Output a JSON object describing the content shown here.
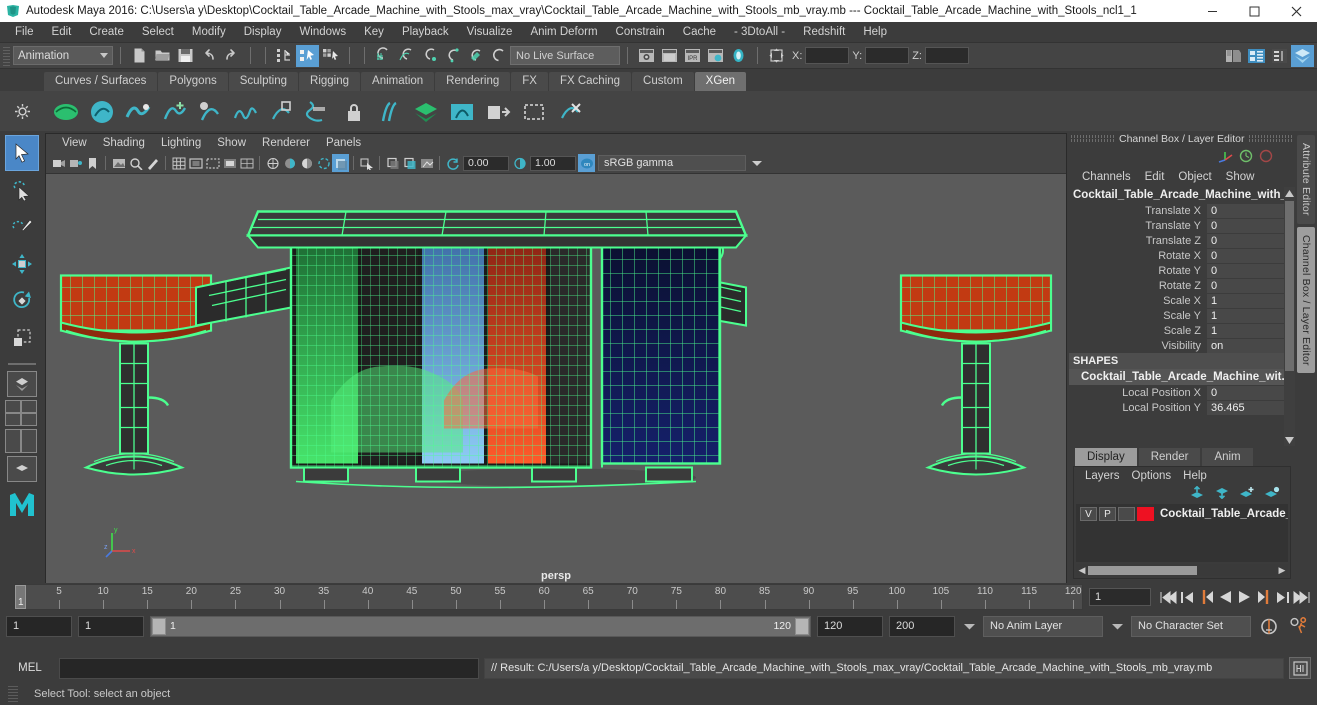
{
  "titlebar": {
    "app_title": "Autodesk Maya 2016: C:\\Users\\a y\\Desktop\\Cocktail_Table_Arcade_Machine_with_Stools_max_vray\\Cocktail_Table_Arcade_Machine_with_Stools_mb_vray.mb  ---  Cocktail_Table_Arcade_Machine_with_Stools_ncl1_1",
    "minimize": "–",
    "maximize": "❐",
    "close": "✕"
  },
  "menubar": {
    "items": [
      {
        "label": "File"
      },
      {
        "label": "Edit"
      },
      {
        "label": "Create"
      },
      {
        "label": "Select"
      },
      {
        "label": "Modify"
      },
      {
        "label": "Display"
      },
      {
        "label": "Windows"
      },
      {
        "label": "Key"
      },
      {
        "label": "Playback"
      },
      {
        "label": "Visualize"
      },
      {
        "label": "Anim Deform"
      },
      {
        "label": "Constrain"
      },
      {
        "label": "Cache"
      },
      {
        "label": "- 3DtoAll -"
      },
      {
        "label": "Redshift"
      },
      {
        "label": "Help"
      }
    ]
  },
  "statusline": {
    "menuset": "Animation",
    "live_surface": "No Live Surface",
    "coord_x_label": "X:",
    "coord_y_label": "Y:",
    "coord_z_label": "Z:",
    "coord_x_value": "",
    "coord_y_value": "",
    "coord_z_value": ""
  },
  "shelf": {
    "tabs": [
      {
        "label": "Curves / Surfaces",
        "active": false
      },
      {
        "label": "Polygons",
        "active": false
      },
      {
        "label": "Sculpting",
        "active": false
      },
      {
        "label": "Rigging",
        "active": false
      },
      {
        "label": "Animation",
        "active": false
      },
      {
        "label": "Rendering",
        "active": false
      },
      {
        "label": "FX",
        "active": false
      },
      {
        "label": "FX Caching",
        "active": false
      },
      {
        "label": "Custom",
        "active": false
      },
      {
        "label": "XGen",
        "active": true
      }
    ]
  },
  "viewport": {
    "menus": [
      {
        "label": "View"
      },
      {
        "label": "Shading"
      },
      {
        "label": "Lighting"
      },
      {
        "label": "Show"
      },
      {
        "label": "Renderer"
      },
      {
        "label": "Panels"
      }
    ],
    "exposure_value": "0.00",
    "gamma_value": "1.00",
    "color_space": "sRGB gamma",
    "camera_label": "persp",
    "axis_x": "x",
    "axis_y": "y",
    "axis_z": "z"
  },
  "channelbox": {
    "panel_title": "Channel Box / Layer Editor",
    "menus": [
      {
        "label": "Channels"
      },
      {
        "label": "Edit"
      },
      {
        "label": "Object"
      },
      {
        "label": "Show"
      }
    ],
    "object_name": "Cocktail_Table_Arcade_Machine_with_...",
    "attributes": [
      {
        "label": "Translate X",
        "value": "0"
      },
      {
        "label": "Translate Y",
        "value": "0"
      },
      {
        "label": "Translate Z",
        "value": "0"
      },
      {
        "label": "Rotate X",
        "value": "0"
      },
      {
        "label": "Rotate Y",
        "value": "0"
      },
      {
        "label": "Rotate Z",
        "value": "0"
      },
      {
        "label": "Scale X",
        "value": "1"
      },
      {
        "label": "Scale Y",
        "value": "1"
      },
      {
        "label": "Scale Z",
        "value": "1"
      },
      {
        "label": "Visibility",
        "value": "on"
      }
    ],
    "shapes_header": "SHAPES",
    "shape_name": "Cocktail_Table_Arcade_Machine_wit...",
    "shape_attributes": [
      {
        "label": "Local Position X",
        "value": "0"
      },
      {
        "label": "Local Position Y",
        "value": "36.465"
      }
    ]
  },
  "dock_tabs": [
    {
      "label": "Attribute Editor",
      "active": false
    },
    {
      "label": "Channel Box / Layer Editor",
      "active": true
    }
  ],
  "layereditor": {
    "tabs": [
      {
        "label": "Display",
        "active": true
      },
      {
        "label": "Render",
        "active": false
      },
      {
        "label": "Anim",
        "active": false
      }
    ],
    "menus": [
      {
        "label": "Layers"
      },
      {
        "label": "Options"
      },
      {
        "label": "Help"
      }
    ],
    "layers": [
      {
        "visibility": "V",
        "playback": "P",
        "state": "",
        "color": "#ee1122",
        "name": "Cocktail_Table_Arcade_M"
      }
    ]
  },
  "timeline": {
    "ticks": [
      5,
      10,
      15,
      20,
      25,
      30,
      35,
      40,
      45,
      50,
      55,
      60,
      65,
      70,
      75,
      80,
      85,
      90,
      95,
      100,
      105,
      110,
      115,
      120
    ],
    "current_frame_marker": "1",
    "current_frame_field": "1",
    "playback_buttons": [
      {
        "name": "go-to-start"
      },
      {
        "name": "step-back-keyframe"
      },
      {
        "name": "step-back-frame"
      },
      {
        "name": "play-backwards"
      },
      {
        "name": "play-forwards"
      },
      {
        "name": "step-forward-frame"
      },
      {
        "name": "step-forward-keyframe"
      },
      {
        "name": "go-to-end"
      }
    ]
  },
  "rangeslider": {
    "anim_start": "1",
    "range_start": "1",
    "bar_start": "1",
    "bar_end": "120",
    "range_end": "120",
    "anim_end": "200",
    "anim_layer": "No Anim Layer",
    "character_set": "No Character Set"
  },
  "commandline": {
    "language": "MEL",
    "input_value": "",
    "result": "// Result: C:/Users/a y/Desktop/Cocktail_Table_Arcade_Machine_with_Stools_max_vray/Cocktail_Table_Arcade_Machine_with_Stools_mb_vray.mb"
  },
  "helpline": {
    "message": "Select Tool: select an object"
  },
  "colors": {
    "accent_blue": "#5a9fd4",
    "teal": "#3fb6c8",
    "wireframe_green": "#4cff8f",
    "layer_red": "#ee1122",
    "viewport_bg": "#5b5b5b"
  }
}
